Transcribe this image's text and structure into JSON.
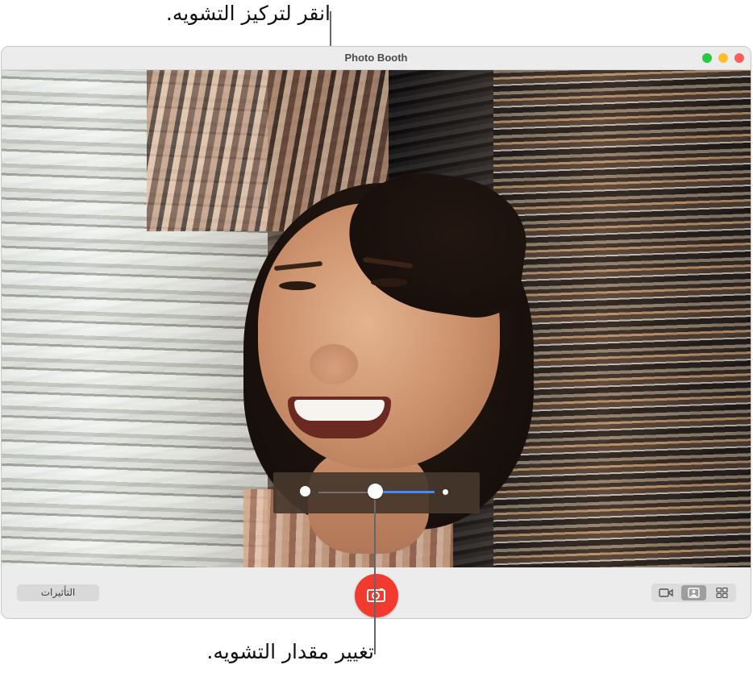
{
  "annotations": {
    "top": "انقر لتركيز التشويه.",
    "bottom": "تغيير مقدار التشويه."
  },
  "window": {
    "title": "Photo Booth",
    "traffic_lights": {
      "zoom_color": "#28c840",
      "minimize_color": "#febc2e",
      "close_color": "#ff5f57"
    }
  },
  "toolbar": {
    "effects_label": "التأثيرات",
    "shutter_color": "#f23a2e",
    "modes": [
      "video-icon",
      "still-photo-icon",
      "four-up-icon"
    ],
    "selected_mode": "still-photo-icon"
  },
  "distortion_slider": {
    "value": 0.45,
    "accent_color": "#3d8df5"
  }
}
